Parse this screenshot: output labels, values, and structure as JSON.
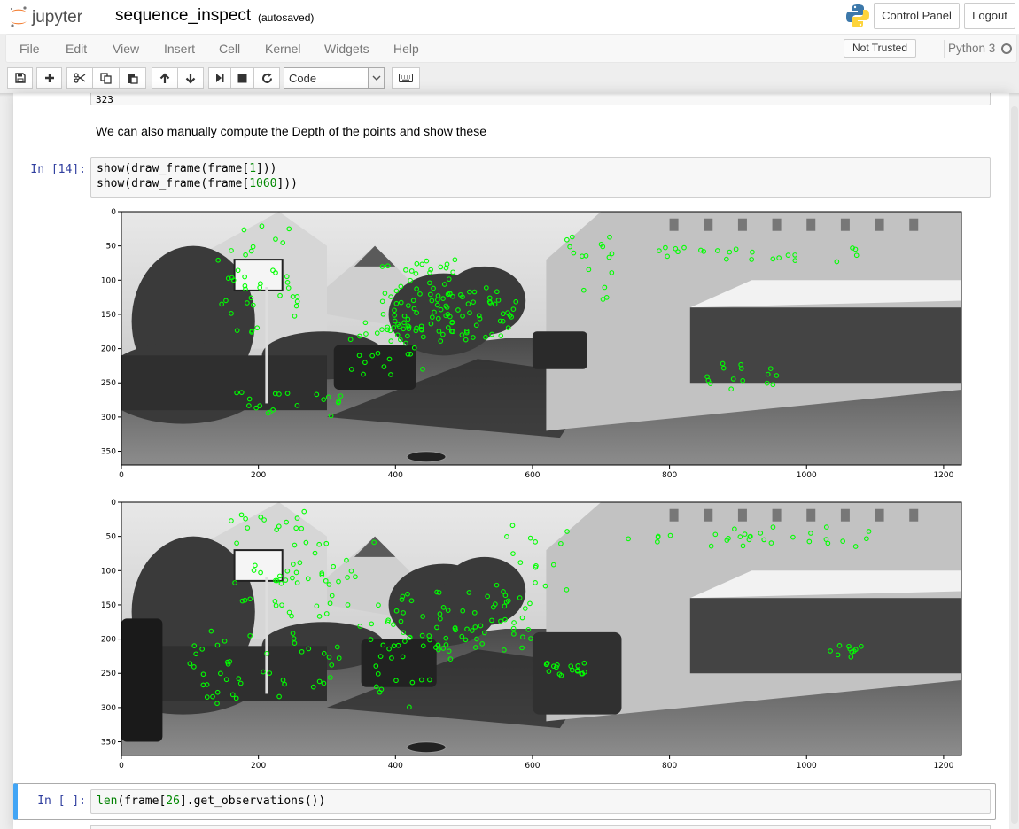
{
  "header": {
    "logo_text": "jupyter",
    "notebook_name": "sequence_inspect",
    "autosave_status": "(autosaved)",
    "control_panel_label": "Control Panel",
    "logout_label": "Logout"
  },
  "menubar": {
    "items": [
      "File",
      "Edit",
      "View",
      "Insert",
      "Cell",
      "Kernel",
      "Widgets",
      "Help"
    ],
    "trust_label": "Not Trusted",
    "kernel_name": "Python 3"
  },
  "toolbar": {
    "cell_type": "Code",
    "buttons": [
      "save-icon",
      "plus-icon",
      "cut-icon",
      "copy-icon",
      "paste-icon",
      "arrow-up-icon",
      "arrow-down-icon",
      "step-forward-icon",
      "stop-icon",
      "restart-icon",
      "keyboard-icon"
    ]
  },
  "notebook": {
    "prev_output_text": "323",
    "markdown_text": "We can also manually compute the Depth of the points and show these",
    "cell_14": {
      "prompt": "In [14]:",
      "lines": [
        {
          "a": "show(draw_frame(frame[",
          "n": "1",
          "b": "]))"
        },
        {
          "a": "show(draw_frame(frame[",
          "n": "1060",
          "b": "]))"
        }
      ]
    },
    "cell_next": {
      "prompt": "In [ ]:",
      "fn": "len",
      "a": "(frame[",
      "n": "26",
      "b": "].get_observations())"
    }
  },
  "plots": [
    {
      "x_ticks": [
        "0",
        "200",
        "400",
        "600",
        "800",
        "1000",
        "1200"
      ],
      "y_ticks": [
        "0",
        "50",
        "100",
        "150",
        "200",
        "250",
        "300",
        "350"
      ],
      "keypoint_color": "#00ff00"
    },
    {
      "x_ticks": [
        "0",
        "200",
        "400",
        "600",
        "800",
        "1000",
        "1200"
      ],
      "y_ticks": [
        "0",
        "50",
        "100",
        "150",
        "200",
        "250",
        "300",
        "350"
      ],
      "keypoint_color": "#00ff00"
    }
  ],
  "colors": {
    "prompt": "#303f9f",
    "selected_cell_border": "#42a5f5",
    "jupyter_orange": "#f37726"
  }
}
